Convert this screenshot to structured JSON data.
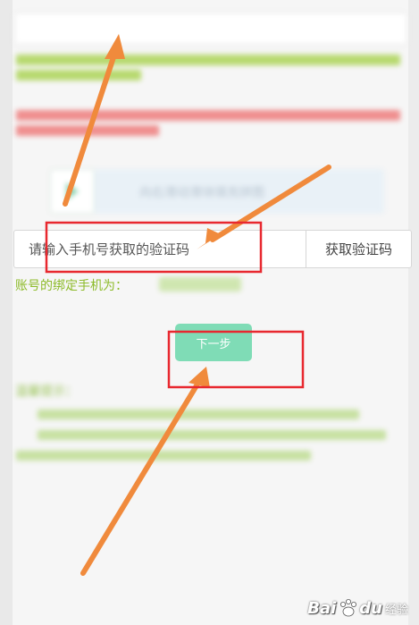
{
  "verify_code": {
    "placeholder": "请输入手机号获取的验证码",
    "get_code_label": "获取验证码"
  },
  "slider": {
    "hint": "向右滑动滑块填充拼图"
  },
  "account": {
    "bound_phone_label": "账号的绑定手机为："
  },
  "next_button_label": "下一步",
  "tips": {
    "title": "温馨提示："
  },
  "watermark": {
    "brand": "Bai",
    "brand2": "du",
    "sub": "经验"
  },
  "colors": {
    "accent_green": "#7fdcb6",
    "note_green": "#8dbb2a",
    "note_red": "#e43b3b",
    "annotation_orange": "#f08a3c",
    "annotation_red": "#e8282f"
  }
}
